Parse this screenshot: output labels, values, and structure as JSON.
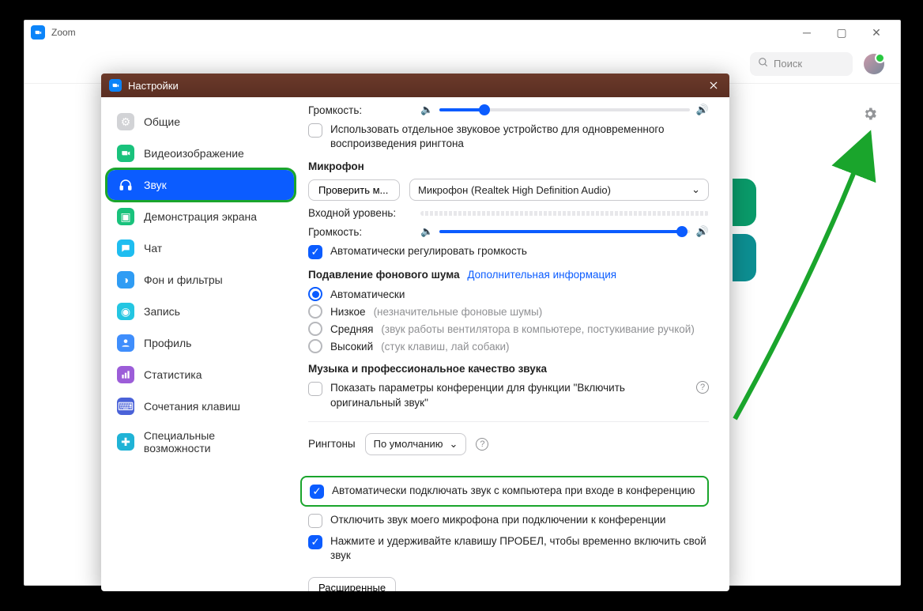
{
  "window": {
    "title": "Zoom"
  },
  "topbar": {
    "search_placeholder": "Поиск"
  },
  "modal": {
    "title": "Настройки",
    "sidebar": [
      {
        "label": "Общие",
        "icon": "gear"
      },
      {
        "label": "Видеоизображение",
        "icon": "video"
      },
      {
        "label": "Звук",
        "icon": "headphones",
        "active": true
      },
      {
        "label": "Демонстрация экрана",
        "icon": "screen"
      },
      {
        "label": "Чат",
        "icon": "chat"
      },
      {
        "label": "Фон и фильтры",
        "icon": "background"
      },
      {
        "label": "Запись",
        "icon": "record"
      },
      {
        "label": "Профиль",
        "icon": "profile"
      },
      {
        "label": "Статистика",
        "icon": "stats"
      },
      {
        "label": "Сочетания клавиш",
        "icon": "keyboard"
      },
      {
        "label": "Специальные возможности",
        "icon": "accessibility"
      }
    ]
  },
  "content": {
    "volume_label": "Громкость:",
    "separate_device": "Использовать отдельное звуковое устройство для одновременного воспроизведения рингтона",
    "microphone_title": "Микрофон",
    "test_mic": "Проверить м...",
    "mic_device": "Микрофон (Realtek High Definition Audio)",
    "input_level": "Входной уровень:",
    "auto_adjust": "Автоматически регулировать громкость",
    "noise_title": "Подавление фонового шума",
    "more_info": "Дополнительная информация",
    "noise_options": [
      {
        "label": "Автоматически",
        "hint": "",
        "selected": true
      },
      {
        "label": "Низкое",
        "hint": "(незначительные фоновые шумы)"
      },
      {
        "label": "Средняя",
        "hint": "(звук работы вентилятора в компьютере, постукивание ручкой)"
      },
      {
        "label": "Высокий",
        "hint": "(стук клавиш, лай собаки)"
      }
    ],
    "music_title": "Музыка и профессиональное качество звука",
    "show_original": "Показать параметры конференции для функции \"Включить оригинальный звук\"",
    "ringtones_label": "Рингтоны",
    "ringtone_selected": "По умолчанию",
    "auto_join": "Автоматически подключать звук с компьютера при входе в конференцию",
    "mute_on_join": "Отключить звук моего микрофона при подключении к конференции",
    "space_unmute": "Нажмите и удерживайте клавишу ПРОБЕЛ, чтобы временно включить свой звук",
    "advanced": "Расширенные",
    "speaker_slider": 18,
    "mic_slider": 97
  }
}
